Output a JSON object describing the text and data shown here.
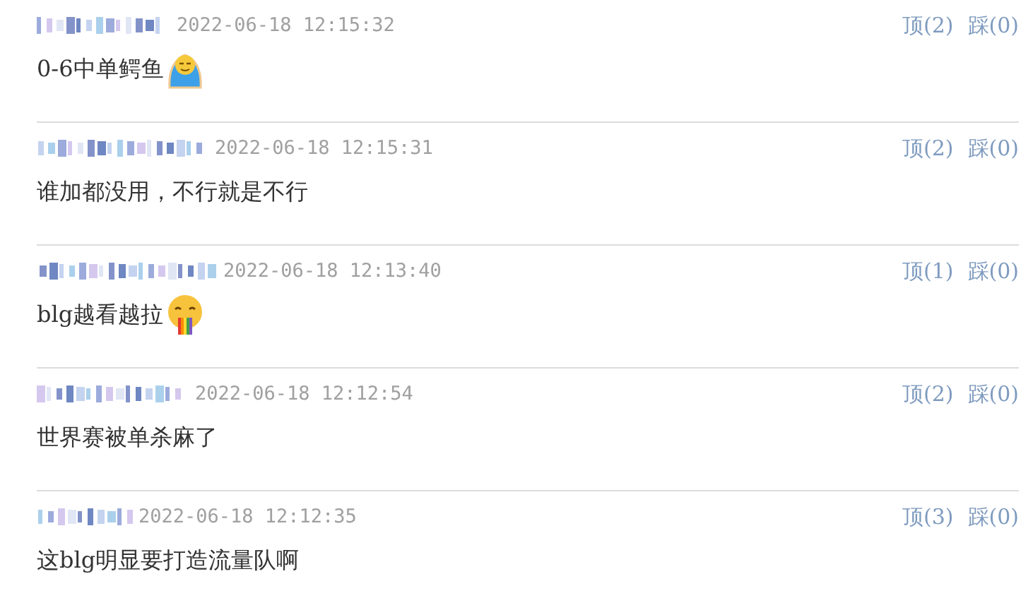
{
  "comments": [
    {
      "time": "2022-06-18 12:15:32",
      "text": "0-6中单鳄鱼",
      "emoji": {
        "kind": "blanket"
      },
      "up": "顶(2)",
      "down": "踩(0)"
    },
    {
      "time": "2022-06-18 12:15:31",
      "text": "谁加都没用，不行就是不行",
      "up": "顶(2)",
      "down": "踩(0)"
    },
    {
      "time": "2022-06-18 12:13:40",
      "text": "blg越看越拉",
      "emoji": {
        "kind": "vomit"
      },
      "up": "顶(1)",
      "down": "踩(0)"
    },
    {
      "time": "2022-06-18 12:12:54",
      "text": "世界赛被单杀麻了",
      "up": "顶(2)",
      "down": "踩(0)"
    },
    {
      "time": "2022-06-18 12:12:35",
      "text": "这blg明显要打造流量队啊",
      "up": "顶(3)",
      "down": "踩(0)"
    }
  ]
}
